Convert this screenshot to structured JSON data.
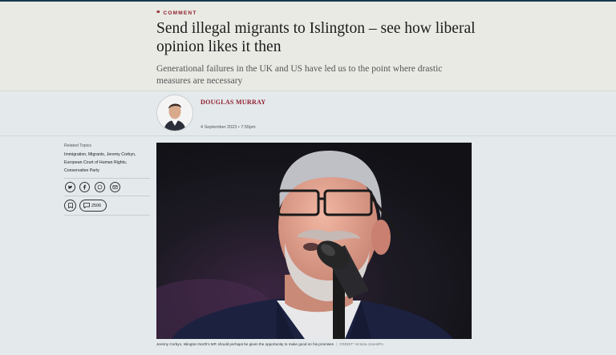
{
  "article": {
    "kicker": "COMMENT",
    "headline": "Send illegal migrants to Islington – see how liberal opinion likes it then",
    "standfirst": "Generational failures in the UK and US have led us to the point where drastic measures are necessary",
    "author": "DOUGLAS MURRAY",
    "date": "4 September 2023 • 7:55pm"
  },
  "sidebar": {
    "related_label": "Related Topics",
    "related_topics": "Immigration, Migrants, Jeremy Corbyn, European Court of Human Rights, Conservative Party",
    "comment_count": "2506",
    "share_icons": [
      "twitter-icon",
      "facebook-icon",
      "whatsapp-icon",
      "email-icon"
    ]
  },
  "image": {
    "caption": "Jeremy Corbyn, Islington North's MP, should perhaps be given the opportunity to make good on his promises",
    "credit_label": "CREDIT:",
    "credit": "Victoria Jones/PA"
  },
  "colors": {
    "kicker": "#8f1d2c",
    "author": "#8f1d2c",
    "header_bg": "#e9eae4",
    "page_bg": "#e4e9ec",
    "topbar": "#173a4f"
  }
}
